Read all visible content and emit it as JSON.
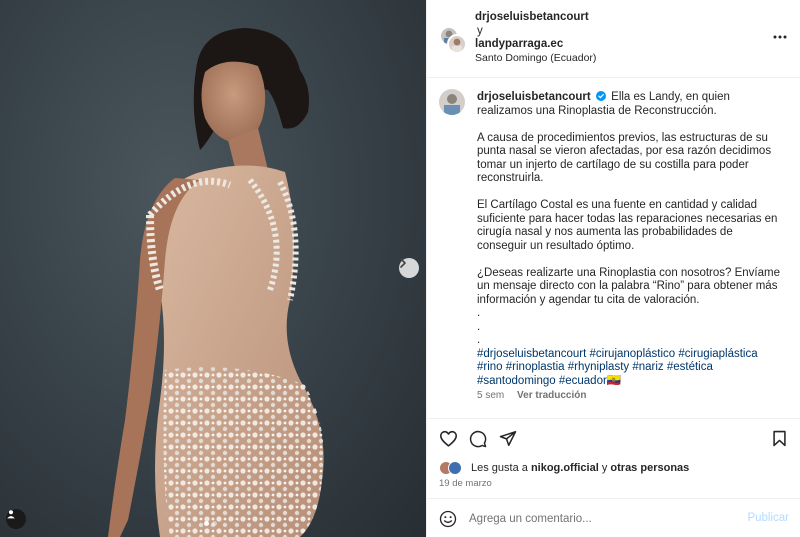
{
  "post": {
    "dots_count": 2,
    "active_dot": 0
  },
  "header": {
    "user1": "drjoseluisbetancourt",
    "conj": "y",
    "user2": "landyparraga.ec",
    "location": "Santo Domingo (Ecuador)"
  },
  "caption": {
    "username": "drjoseluisbetancourt",
    "intro": "Ella es Landy, en quien realizamos una Rinoplastia de Reconstrucción.",
    "para1": "A causa de procedimientos previos, las estructuras de su punta nasal se vieron afectadas, por esa razón decidimos tomar un injerto de cartílago de su costilla para poder reconstruirla.",
    "para2": "El Cartílago Costal es una fuente en cantidad y calidad suficiente para hacer todas las reparaciones necesarias en cirugía nasal y nos aumenta las probabilidades de conseguir un resultado óptimo.",
    "para3": "¿Deseas realizarte una Rinoplastia con nosotros? Envíame un mensaje directo con la palabra “Rino” para obtener más información y agendar tu cita de valoración.",
    "dot1": ".",
    "dot2": ".",
    "dot3": ".",
    "hashtags": "#drjoseluisbetancourt #cirujanoplástico #cirugiaplástica #rino #rinoplastia #rhyniplasty #nariz #estética #santodomingo #ecuador🇪🇨",
    "time": "5 sem",
    "translate": "Ver traducción"
  },
  "likes": {
    "prefix": "Les gusta a",
    "user": "nikog.official",
    "conj": "y",
    "others": "otras personas"
  },
  "date": "19 de marzo",
  "comment": {
    "placeholder": "Agrega un comentario...",
    "publish": "Publicar"
  },
  "colors": {
    "link": "#00376b",
    "verified": "#0095f6",
    "publish_disabled": "#b3dbff"
  }
}
